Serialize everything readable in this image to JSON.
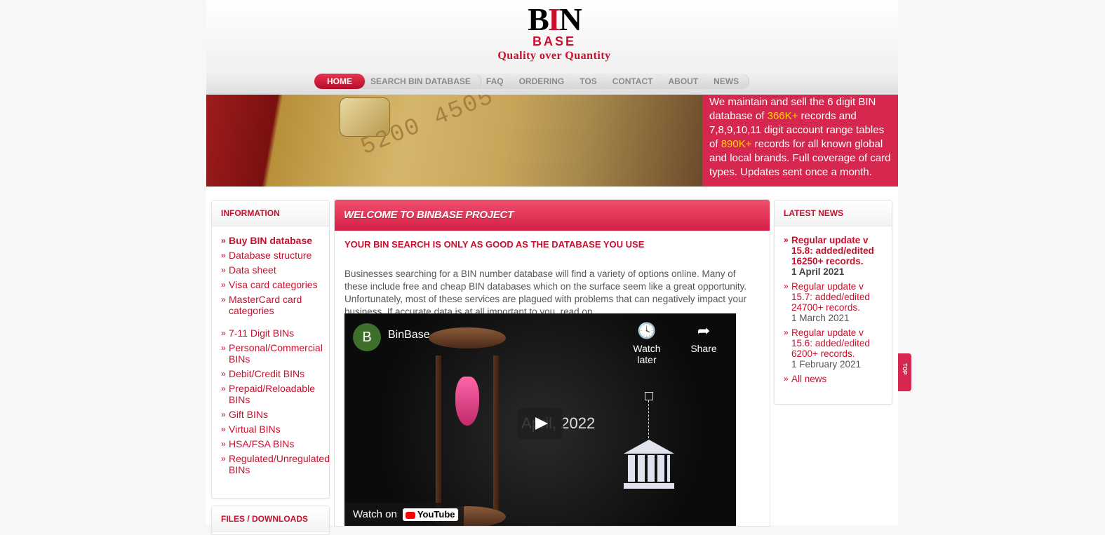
{
  "brand": {
    "logo_b": "B",
    "logo_i": "I",
    "logo_n": "N",
    "logo_base": "BASE",
    "tagline": "Quality over Quantity"
  },
  "nav": {
    "items": [
      "Home",
      "Search BIN database",
      "FAQ",
      "Ordering",
      "TOS",
      "Contact",
      "About",
      "News"
    ],
    "active": "Home"
  },
  "banner": {
    "card_number": "5200 4505",
    "line1": "We maintain and sell the 6 digit BIN database of ",
    "records_bin": "366K+",
    "line2": " records and 7,8,9,10,11 digit account range tables of ",
    "records_range": "890K+",
    "line3": " records for all known global and local brands. Full coverage of card types. Updates sent once a month."
  },
  "sidebar": {
    "title": "Information",
    "items": [
      "Buy BIN database",
      "Database structure",
      "Data sheet",
      "Visa card categories",
      "MasterCard card categories",
      "7-11 Digit BINs",
      "Personal/Commercial BINs",
      "Debit/Credit BINs",
      "Prepaid/Reloadable BINs",
      "Gift BINs",
      "Virtual BINs",
      "HSA/FSA BINs",
      "Regulated/Unregulated BINs"
    ],
    "files_title": "Files / Downloads"
  },
  "main": {
    "title": "Welcome to BinBase project",
    "subtitle": "YOUR BIN SEARCH IS ONLY AS GOOD AS THE DATABASE YOU USE",
    "body": "Businesses searching for a BIN number database will find a variety of options online. Many of these include free and cheap BIN databases which on the surface seem like a great opportunity. Unfortunately, most of these services are plagued with problems that can negatively impact your business. If accurate data is at all important to you, read on.",
    "video": {
      "channel_initial": "B",
      "channel_name": "BinBase",
      "watch_later": "Watch later",
      "share": "Share",
      "date_overlay": "April, 2022",
      "watch_on": "Watch on",
      "platform": "YouTube"
    }
  },
  "news": {
    "title": "Latest news",
    "items": [
      {
        "text": "Regular update v 15.8: added/edited 16250+ records.",
        "date": "1 April 2021"
      },
      {
        "text": "Regular update v 15.7: added/edited 24700+ records.",
        "date": "1 March 2021"
      },
      {
        "text": "Regular update v 15.6: added/edited 6200+ records.",
        "date": "1 February 2021"
      }
    ],
    "all_news": "All news"
  },
  "top_button": "TOP"
}
